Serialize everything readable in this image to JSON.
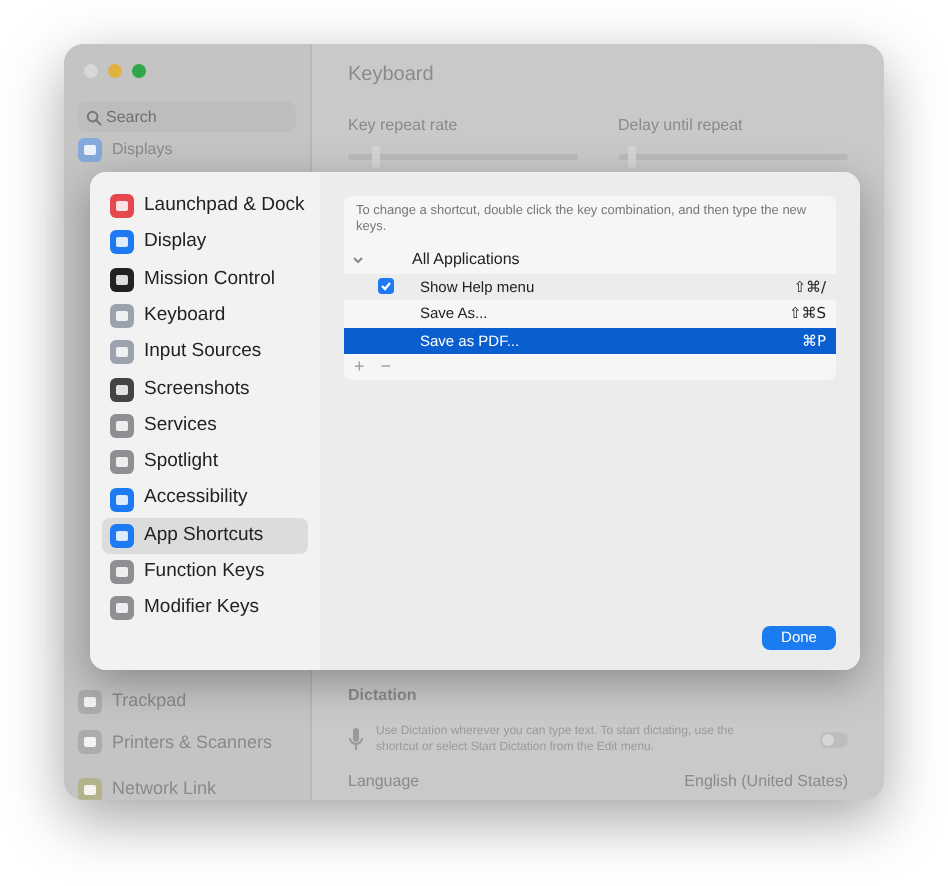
{
  "window": {
    "title": "Keyboard",
    "search": {
      "placeholder": "Search"
    },
    "sidebar_items": [
      {
        "label": "Displays",
        "color": "#86a9dc"
      },
      {
        "label": "Trackpad",
        "color": "#acacac"
      },
      {
        "label": "Printers & Scanners",
        "color": "#acacac"
      },
      {
        "label": "Network Link",
        "color": "#b3b38c"
      }
    ],
    "sliders": [
      {
        "label": "Key repeat rate",
        "level": 0.1
      },
      {
        "label": "Delay until repeat",
        "level": 0.04
      }
    ],
    "dictation": {
      "heading": "Dictation",
      "description": "Use Dictation wherever you can type text. To start dictating, use the shortcut or select Start Dictation from the Edit menu.",
      "on": false
    },
    "language": {
      "label": "Language",
      "value": "English (United States)"
    }
  },
  "sheet": {
    "sidebar": [
      {
        "label": "Launchpad & Dock",
        "selected": false,
        "color": "#e5484d"
      },
      {
        "label": "Display",
        "selected": false,
        "color": "#1d7af3"
      },
      {
        "label": "Mission Control",
        "selected": false,
        "color": "#222222"
      },
      {
        "label": "Keyboard",
        "selected": false,
        "color": "#9ca3af"
      },
      {
        "label": "Input Sources",
        "selected": false,
        "color": "#9ca3af"
      },
      {
        "label": "Screenshots",
        "selected": false,
        "color": "#444444"
      },
      {
        "label": "Services",
        "selected": false,
        "color": "#8e8e93"
      },
      {
        "label": "Spotlight",
        "selected": false,
        "color": "#8e8e93"
      },
      {
        "label": "Accessibility",
        "selected": false,
        "color": "#1d7af3"
      },
      {
        "label": "App Shortcuts",
        "selected": true,
        "color": "#1d7af3"
      },
      {
        "label": "Function Keys",
        "selected": false,
        "color": "#8e8e93"
      },
      {
        "label": "Modifier Keys",
        "selected": false,
        "color": "#8e8e93"
      }
    ],
    "description": "To change a shortcut, double click the key combination, and then type the new keys.",
    "group": {
      "label": "All Applications",
      "expanded": true,
      "children": [
        {
          "label": "Show Help menu",
          "shortcut": "⇧⌘/",
          "checkbox": true,
          "checked": true,
          "selected": false
        },
        {
          "label": "Save As...",
          "shortcut": "⇧⌘S",
          "checkbox": false,
          "selected": false
        },
        {
          "label": "Save as PDF...",
          "shortcut": "⌘P",
          "checkbox": false,
          "selected": true
        }
      ]
    },
    "add": "+",
    "remove": "−",
    "done": "Done"
  }
}
